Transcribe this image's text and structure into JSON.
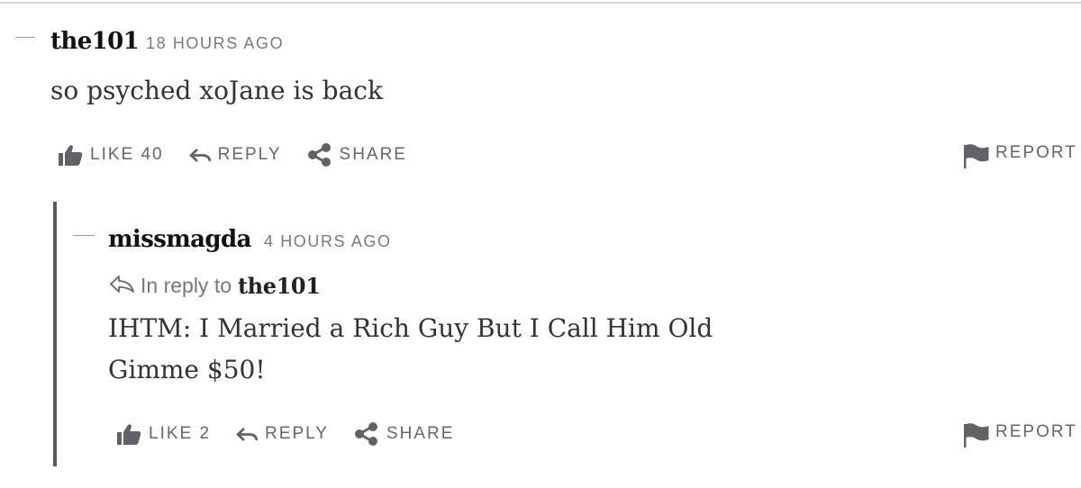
{
  "comments": [
    {
      "author": "the101",
      "time": "18 HOURS AGO",
      "body": "so psyched xoJane is back",
      "like_label": "LIKE 40",
      "reply_label": "REPLY",
      "share_label": "SHARE",
      "report_label": "REPORT"
    },
    {
      "author": "missmagda",
      "time": "4 HOURS AGO",
      "in_reply_to_label": "In reply to",
      "in_reply_to_author": "the101",
      "body_lines": [
        "IHTM: I Married a Rich Guy But I Call Him Old",
        "Gimme $50!"
      ],
      "like_label": "LIKE 2",
      "reply_label": "REPLY",
      "share_label": "SHARE",
      "report_label": "REPORT"
    }
  ],
  "icons": {
    "like": "thumbs-up-icon",
    "reply": "reply-arrow-icon",
    "share": "share-icon",
    "report": "flag-icon",
    "in_reply_to": "reply-outline-icon"
  },
  "colors": {
    "text": "#222222",
    "muted": "#7a7a7a",
    "icon": "#5f6368",
    "thread_bar": "#555b60",
    "divider": "#d4d9dc"
  }
}
